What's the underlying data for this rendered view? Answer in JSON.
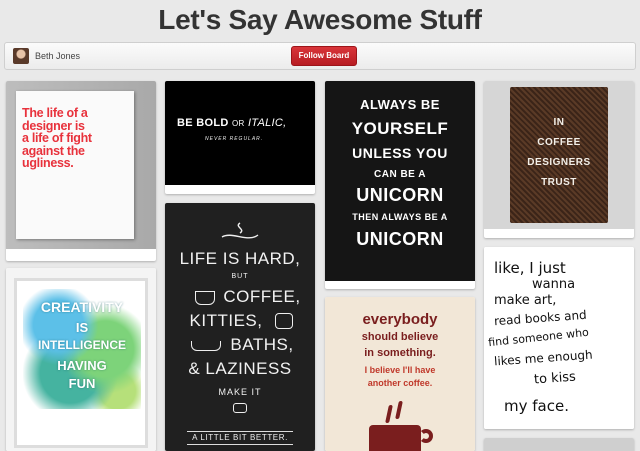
{
  "board": {
    "title": "Let's Say Awesome Stuff"
  },
  "bar": {
    "owner": "Beth Jones",
    "follow_label": "Follow Board"
  },
  "pins": {
    "designer": {
      "lines": [
        "The life of a",
        "designer is",
        "a life of fight",
        "against the",
        "ugliness."
      ]
    },
    "creativity": {
      "lines": [
        "CREATIVITY",
        "IS",
        "INTELLIGENCE",
        "HAVING",
        "FUN"
      ]
    },
    "bold": {
      "bold": "BE BOLD",
      "or": "OR",
      "italic": "ITALIC,",
      "never": "NEVER REGULAR."
    },
    "lifehard": {
      "lines": [
        "LIFE IS HARD,",
        "BUT",
        "COFFEE,",
        "KITTIES,",
        "BATHS,",
        "& LAZINESS",
        "MAKE IT"
      ],
      "bottom": "A LITTLE BIT BETTER."
    },
    "unicorn": {
      "lines": [
        "ALWAYS BE",
        "YOURSELF",
        "UNLESS YOU",
        "CAN BE A",
        "UNICORN",
        "THEN ALWAYS BE A",
        "UNICORN"
      ]
    },
    "everybody": {
      "lines": [
        "everybody",
        "should believe",
        "in something.",
        "I believe I'll have",
        "another coffee."
      ]
    },
    "coffee": {
      "lines": [
        "IN",
        "COFFEE",
        "DESIGNERS",
        "TRUST"
      ]
    },
    "handwritten": {
      "lines": [
        "like, I just",
        "wanna",
        "make art,",
        "read books and",
        "find someone who",
        "likes me enough",
        "to kiss",
        "my face."
      ]
    }
  },
  "colors": {
    "follow_button": "#c8232c",
    "designer_text": "#e8323c",
    "everybody_text": "#7a1e1e",
    "background": "#e9e9e9"
  }
}
